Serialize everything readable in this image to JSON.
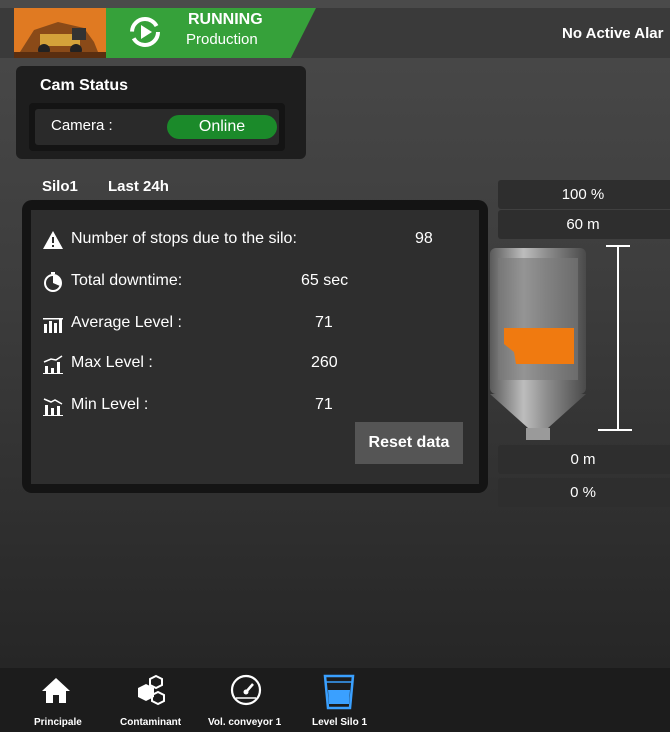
{
  "header": {
    "status_title": "RUNNING",
    "status_subtitle": "Production",
    "alarm_text": "No Active Alar"
  },
  "cam_status": {
    "title": "Cam Status",
    "camera_label": "Camera :",
    "camera_value": "Online"
  },
  "silo": {
    "name": "Silo1",
    "period": "Last 24h",
    "stats": [
      {
        "icon": "warning-icon",
        "label": "Number of stops due to the silo:",
        "value": "98"
      },
      {
        "icon": "stopwatch-icon",
        "label": "Total downtime:",
        "value": "65 sec"
      },
      {
        "icon": "average-level-icon",
        "label": "Average Level :",
        "value": "71"
      },
      {
        "icon": "max-level-icon",
        "label": "Max Level :",
        "value": "260"
      },
      {
        "icon": "min-level-icon",
        "label": "Min Level :",
        "value": "71"
      }
    ],
    "reset_label": "Reset data"
  },
  "level_gauge": {
    "top_percent": "100 %",
    "top_meters": "60 m",
    "bottom_meters": "0 m",
    "bottom_percent": "0 %",
    "fill_color": "#f07a10"
  },
  "nav": {
    "items": [
      {
        "label": "Principale",
        "icon": "home-icon"
      },
      {
        "label": "Contaminant",
        "icon": "cubes-icon"
      },
      {
        "label": "Vol. conveyor 1",
        "icon": "speedometer-icon"
      },
      {
        "label": "Level Silo 1",
        "icon": "glass-icon",
        "active": true
      }
    ]
  },
  "colors": {
    "running_green": "#36a13a",
    "online_green": "#1b8a2a",
    "active_blue": "#3aa0ff",
    "silo_fill": "#f07a10"
  }
}
